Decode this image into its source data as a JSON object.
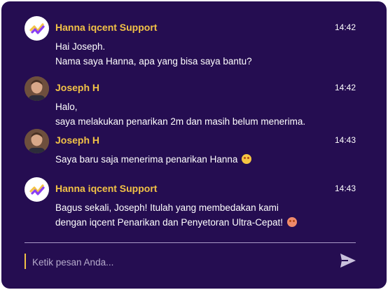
{
  "messages": [
    {
      "sender": "Hanna iqcent Support",
      "avatar": "iqcent-logo-icon",
      "time": "14:42",
      "lines": [
        "Hai Joseph.",
        "Nama saya Hanna, apa yang bisa saya bantu?"
      ]
    },
    {
      "sender": "Joseph H",
      "avatar": "user-photo",
      "time": "14:42",
      "lines": [
        "Halo,",
        "saya melakukan penarikan 2m dan masih belum menerima."
      ]
    },
    {
      "sender": "Joseph H",
      "avatar": "user-photo",
      "time": "14:43",
      "lines": [
        "Saya baru saja menerima penarikan Hanna"
      ],
      "emoji": "star-struck-emoji"
    },
    {
      "sender": "Hanna iqcent Support",
      "avatar": "iqcent-logo-icon",
      "time": "14:43",
      "lines": [
        "Bagus sekali, Joseph! Itulah yang membedakan kami",
        "dengan iqcent Penarikan dan Penyetoran Ultra-Cepat!"
      ],
      "emoji": "smiling-face-with-hearts-emoji"
    }
  ],
  "composer": {
    "placeholder": "Ketik pesan Anda...",
    "send_icon": "send-icon"
  },
  "colors": {
    "background": "#250d51",
    "name": "#f2c246",
    "text": "#ffffff",
    "divider": "#a999c6"
  }
}
